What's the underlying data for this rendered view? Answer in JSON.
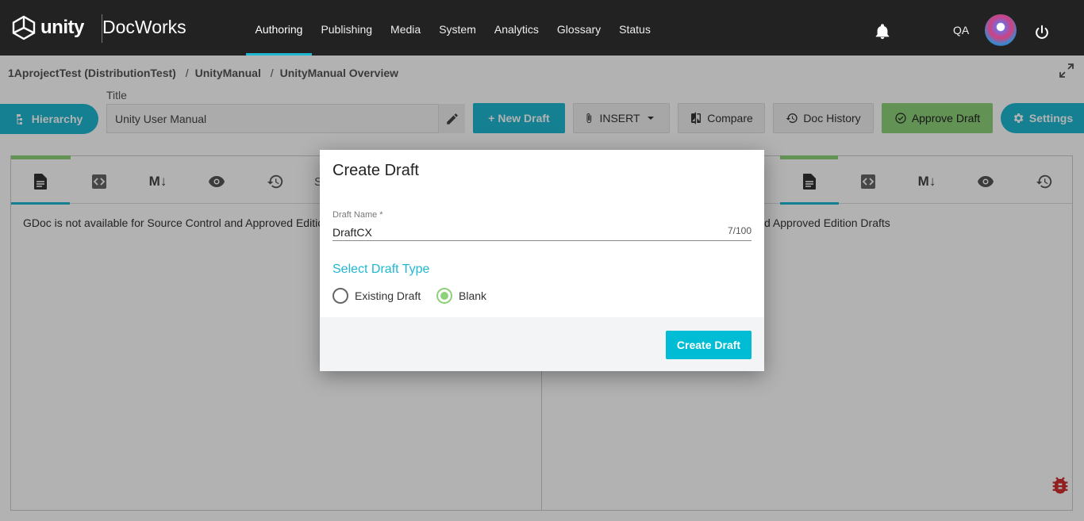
{
  "app": {
    "logo_text": "unity",
    "product": "DocWorks"
  },
  "nav": {
    "items": [
      {
        "label": "Authoring",
        "active": true
      },
      {
        "label": "Publishing"
      },
      {
        "label": "Media"
      },
      {
        "label": "System"
      },
      {
        "label": "Analytics"
      },
      {
        "label": "Glossary"
      },
      {
        "label": "Status"
      }
    ],
    "user_label": "QA"
  },
  "breadcrumb": {
    "project": "1AprojectTest (DistributionTest)",
    "sep1": "/",
    "manual": "UnityManual",
    "sep2": "/",
    "page": "UnityManual Overview"
  },
  "toolbar": {
    "hierarchy": "Hierarchy",
    "title_label": "Title",
    "title_value": "Unity User Manual",
    "new_draft": "+ New Draft",
    "insert": "INSERT",
    "compare": "Compare",
    "doc_history": "Doc History",
    "approve_draft": "Approve Draft",
    "settings": "Settings"
  },
  "panes": {
    "left_tab_partial": "S",
    "left_message": "GDoc is not available for Source Control and Approved Editio",
    "right_message": "d Approved Edition Drafts",
    "tab_markdown": "M↓"
  },
  "dialog": {
    "title": "Create Draft",
    "draft_name_label": "Draft Name *",
    "draft_name_value": "DraftCX",
    "counter": "7/100",
    "section_title": "Select Draft Type",
    "options": [
      {
        "label": "Existing Draft",
        "checked": false
      },
      {
        "label": "Blank",
        "checked": true
      }
    ],
    "submit": "Create Draft"
  },
  "colors": {
    "accent": "#1fb8d0",
    "approve": "#8ed17a",
    "topbar": "#222222"
  }
}
